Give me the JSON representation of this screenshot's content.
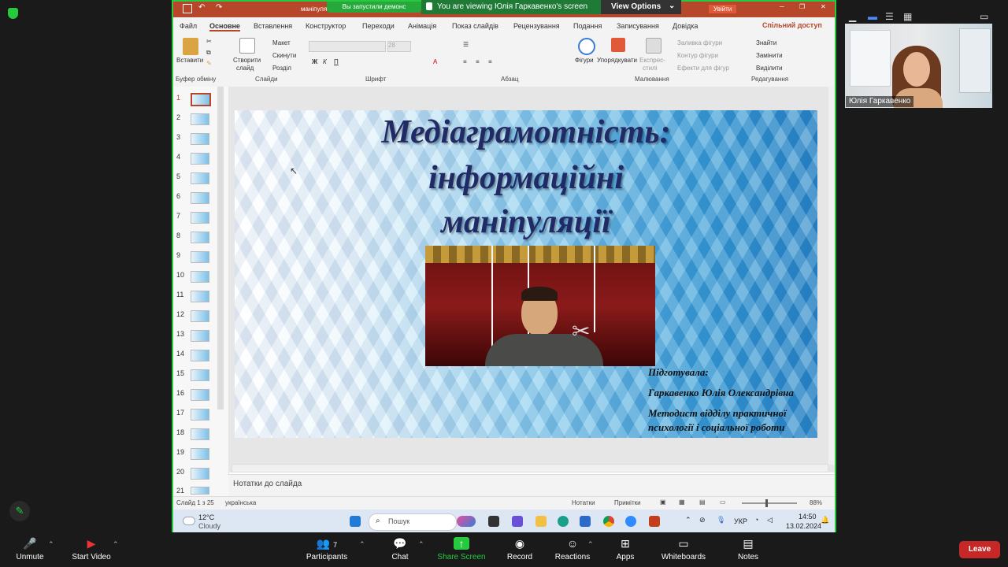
{
  "zoom": {
    "banner_text": "You are viewing Юлія Гаркавенко's screen",
    "pp_notice": "Вы запустили демонс",
    "video_options": "View Options",
    "participant_name": "Юлія Гаркавенко",
    "participants_count": "7",
    "toolbar": {
      "unmute": "Unmute",
      "start_video": "Start Video",
      "participants": "Participants",
      "chat": "Chat",
      "share_screen": "Share Screen",
      "record": "Record",
      "reactions": "Reactions",
      "apps": "Apps",
      "whiteboards": "Whiteboards",
      "notes": "Notes",
      "leave": "Leave"
    }
  },
  "powerpoint": {
    "file_name": "маніпуля",
    "signin": "Увійти",
    "tabs": [
      "Файл",
      "Основне",
      "Вставлення",
      "Конструктор",
      "Переходи",
      "Анімація",
      "Показ слайдів",
      "Рецензування",
      "Подання",
      "Записування",
      "Довідка"
    ],
    "share": "Спільний доступ",
    "ribbon": {
      "paste": "Вставити",
      "clipboard": "Буфер обміну",
      "new_slide_1": "Створити",
      "new_slide_2": "слайд",
      "layout": "Макет",
      "reset": "Скинути",
      "section": "Розділ",
      "slides": "Слайди",
      "font_size": "28",
      "font": "Шрифт",
      "paragraph": "Абзац",
      "shapes": "Фігури",
      "arrange": "Упорядкувати",
      "quick_styles_1": "Експрес-",
      "quick_styles_2": "стилі",
      "shape_fill": "Заливка фігури",
      "shape_outline": "Контур фігури",
      "shape_effects": "Ефекти для фігур",
      "drawing": "Малювання",
      "find": "Знайти",
      "replace": "Замінити",
      "select": "Виділити",
      "editing": "Редагування"
    },
    "thumbnails": [
      "1",
      "2",
      "3",
      "4",
      "5",
      "6",
      "7",
      "8",
      "9",
      "10",
      "11",
      "12",
      "13",
      "14",
      "15",
      "16",
      "17",
      "18",
      "19",
      "20",
      "21"
    ],
    "slide": {
      "title_line1": "Медіаграмотність:",
      "title_line2": "інформаційні",
      "title_line3": "маніпуляції",
      "prepared": "Підготувала:",
      "author": "Гаркавенко Юлія Олександрівна",
      "role_line1": "Методист відділу практичної",
      "role_line2": "психології і соціальної роботи"
    },
    "notes_placeholder": "Нотатки до слайда",
    "status": {
      "slide_count": "Слайд 1 з 25",
      "language": "українська",
      "notes": "Нотатки",
      "comments": "Примітки",
      "zoom": "88%"
    }
  },
  "taskbar": {
    "temp": "12°C",
    "weather": "Cloudy",
    "search": "Пошук",
    "lang": "УКР",
    "time": "14:50",
    "date": "13.02.2024"
  },
  "colors": {
    "accent_green": "#27c93f",
    "ppt_red": "#b7472a",
    "leave_red": "#c62828"
  }
}
